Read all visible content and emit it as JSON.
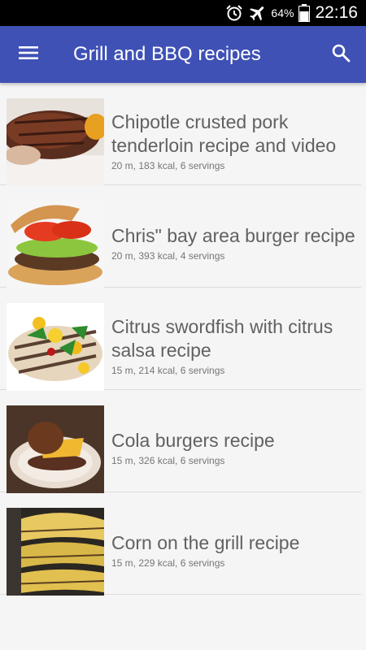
{
  "status_bar": {
    "battery_percent": "64%",
    "time": "22:16",
    "icons": [
      "alarm-icon",
      "airplane-icon",
      "battery-icon"
    ]
  },
  "app_bar": {
    "title": "Grill and BBQ recipes",
    "menu_icon": "menu-icon",
    "search_icon": "search-icon"
  },
  "recipes": [
    {
      "title": "Chipotle crusted pork tenderloin recipe and video",
      "meta": "20 m, 183 kcal, 6 servings"
    },
    {
      "title": "Chris\" bay area burger recipe",
      "meta": "20 m, 393 kcal, 4 servings"
    },
    {
      "title": "Citrus swordfish with citrus salsa recipe",
      "meta": "15 m, 214 kcal, 6 servings"
    },
    {
      "title": "Cola burgers recipe",
      "meta": "15 m, 326 kcal, 6 servings"
    },
    {
      "title": "Corn on the grill recipe",
      "meta": "15 m, 229 kcal, 6 servings"
    }
  ],
  "colors": {
    "app_bar": "#3f51b5",
    "background": "#f5f5f5",
    "title_text": "#616161",
    "meta_text": "#757575"
  }
}
